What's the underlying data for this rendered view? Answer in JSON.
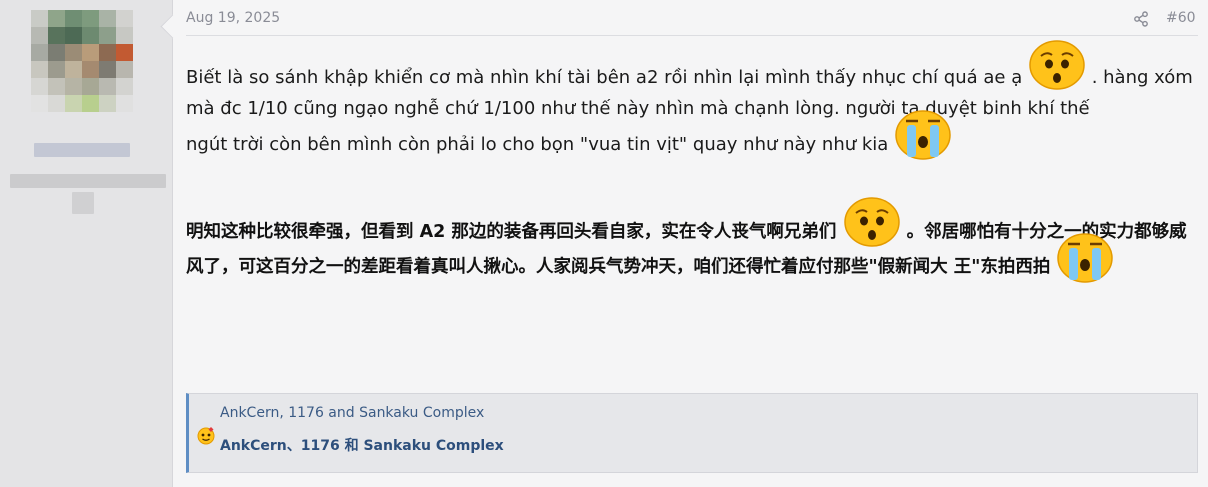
{
  "post": {
    "date": "Aug 19, 2025",
    "number": "#60",
    "share_icon": "share-icon",
    "vi": {
      "seg1": "Biết là so sánh khập khiển cơ mà nhìn khí tài bên a2 rồi nhìn lại mình thấy nhục chí quá ae ạ",
      "seg2": ". hàng xóm mà đc 1/10 cũng ngạo nghễ chứ 1/100 như thế này nhìn mà chạnh lòng. người ta duyệt binh khí thế",
      "seg3": "ngút trời còn bên mình còn phải lo cho bọn \"vua tin vịt\" quay như này như kia"
    },
    "zh": {
      "seg1": "明知这种比较很牵强，但看到 A2 那边的装备再回头看自家，实在令人丧气啊兄弟们",
      "seg2": "。邻居哪怕有十分之一的实力都够威风了，可这百分之一的差距看着真叫人揪心。人家阅兵气势冲天，咱们还得忙着应付那些\"假新闻大",
      "seg3": "王\"东拍西拍"
    },
    "emojis": [
      "worried-face-emoji",
      "crying-face-emoji"
    ]
  },
  "reactions": {
    "line1": "AnkCern, 1176 and Sankaku Complex",
    "line2": "AnkCern、1176 和 Sankaku Complex",
    "icon": "reaction-icon"
  },
  "colors": {
    "accent": "#5f8ec4",
    "link": "#2d4f7c",
    "muted": "#8a8c96",
    "emoji_yellow": "#ffc21a"
  }
}
